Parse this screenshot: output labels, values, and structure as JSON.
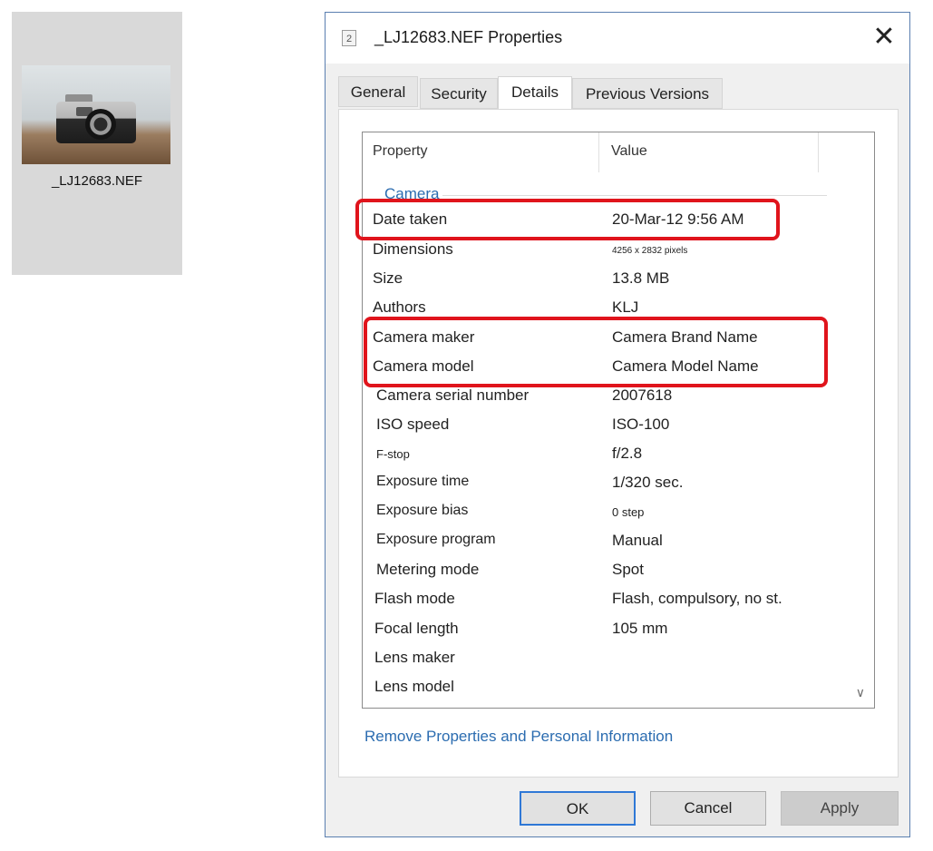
{
  "desktop": {
    "file_name": "_LJ12683.NEF"
  },
  "dialog": {
    "title": "_LJ12683.NEF Properties",
    "close_glyph": "✕",
    "title_icon_glyph": "2",
    "tabs": [
      {
        "label": "General",
        "active": false
      },
      {
        "label": "Security",
        "active": false
      },
      {
        "label": "Details",
        "active": true
      },
      {
        "label": "Previous Versions",
        "active": false
      }
    ],
    "columns": {
      "property": "Property",
      "value": "Value"
    },
    "group": "Camera",
    "rows": [
      {
        "name": "Date taken",
        "value": "20-Mar-12 9:56 AM"
      },
      {
        "name": "Dimensions",
        "value": "4256 x 2832 pixels"
      },
      {
        "name": "Size",
        "value": "13.8 MB"
      },
      {
        "name": "Authors",
        "value": "KLJ"
      },
      {
        "name": "Camera maker",
        "value": "Camera Brand Name"
      },
      {
        "name": "Camera model",
        "value": "Camera Model Name"
      },
      {
        "name": "Camera serial number",
        "value": "2007618"
      },
      {
        "name": "ISO speed",
        "value": "ISO-100"
      },
      {
        "name": "F-stop",
        "value": "f/2.8"
      },
      {
        "name": "Exposure time",
        "value": "1/320 sec."
      },
      {
        "name": "Exposure bias",
        "value": "0 step"
      },
      {
        "name": "Exposure program",
        "value": "Manual"
      },
      {
        "name": "Metering mode",
        "value": "Spot"
      },
      {
        "name": "Flash mode",
        "value": "Flash, compulsory, no st."
      },
      {
        "name": "Focal length",
        "value": "105 mm"
      },
      {
        "name": "Lens maker",
        "value": ""
      },
      {
        "name": "Lens model",
        "value": ""
      }
    ],
    "scroll_glyph": "∨",
    "remove_link": "Remove Properties and Personal Information",
    "buttons": {
      "ok": "OK",
      "cancel": "Cancel",
      "apply": "Apply"
    }
  },
  "colors": {
    "highlight": "#e0141c",
    "link": "#2b6cb0",
    "ok_border": "#2f78d6"
  },
  "icons": [
    "file-thumbnail-camera",
    "file-type-icon",
    "close-icon",
    "chevron-down-icon"
  ]
}
